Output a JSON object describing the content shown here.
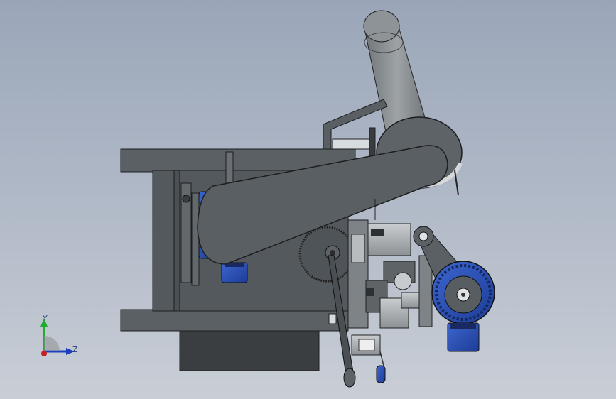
{
  "viewport": {
    "background_top": "#9aa6b8",
    "background_bottom": "#c9ced6"
  },
  "triad": {
    "x_label": "",
    "y_label": "Y",
    "z_label": "Z",
    "y_color": "#1fae2b",
    "z_color": "#1c3fbf",
    "origin_color": "#c81e1e"
  },
  "model": {
    "body_color": "#5d6266",
    "motor_color": "#2f55b8",
    "edge_color": "#1c1e20"
  }
}
